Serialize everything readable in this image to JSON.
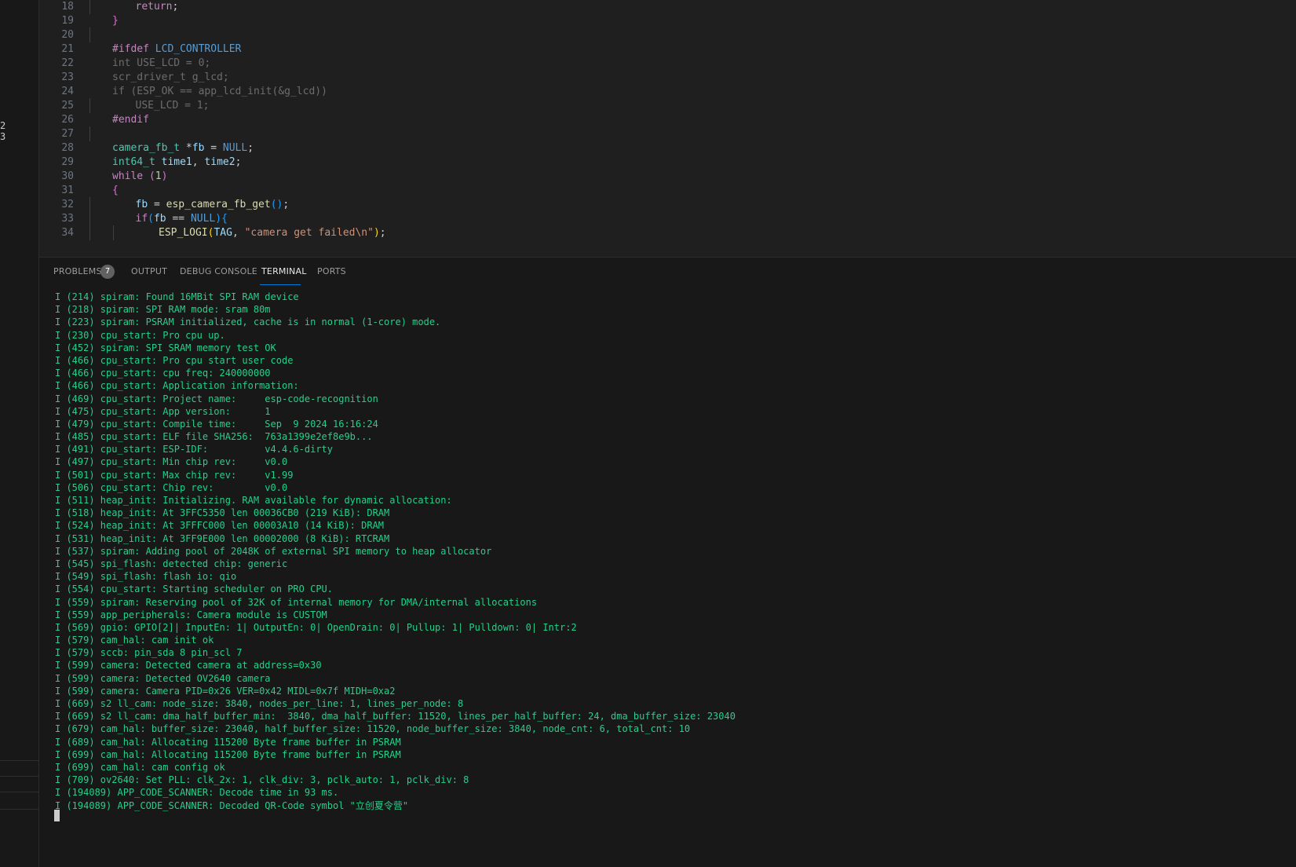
{
  "sidebar": {
    "numbers": [
      "2",
      "3"
    ]
  },
  "editor": {
    "lines": [
      {
        "n": "18",
        "indent": 2,
        "tokens": [
          [
            "kw-ctrl",
            "return"
          ],
          [
            "punc",
            ";"
          ]
        ]
      },
      {
        "n": "19",
        "indent": 1,
        "tokens": [
          [
            "brace2",
            "}"
          ]
        ]
      },
      {
        "n": "20",
        "indent": 0,
        "tokens": []
      },
      {
        "n": "21",
        "indent": 1,
        "tokens": [
          [
            "pp",
            "#ifdef"
          ],
          [
            "punc",
            " "
          ],
          [
            "macro",
            "LCD_CONTROLLER"
          ]
        ]
      },
      {
        "n": "22",
        "indent": 1,
        "tokens": [
          [
            "dim",
            "int USE_LCD = 0;"
          ]
        ]
      },
      {
        "n": "23",
        "indent": 1,
        "tokens": [
          [
            "dim",
            "scr_driver_t g_lcd;"
          ]
        ]
      },
      {
        "n": "24",
        "indent": 1,
        "tokens": [
          [
            "dim",
            "if (ESP_OK == app_lcd_init(&g_lcd))"
          ]
        ]
      },
      {
        "n": "25",
        "indent": 2,
        "tokens": [
          [
            "dim",
            "USE_LCD = 1;"
          ]
        ]
      },
      {
        "n": "26",
        "indent": 1,
        "tokens": [
          [
            "pp",
            "#endif"
          ]
        ]
      },
      {
        "n": "27",
        "indent": 0,
        "tokens": []
      },
      {
        "n": "28",
        "indent": 1,
        "tokens": [
          [
            "type",
            "camera_fb_t"
          ],
          [
            "punc",
            " *"
          ],
          [
            "var",
            "fb"
          ],
          [
            "punc",
            " = "
          ],
          [
            "macro",
            "NULL"
          ],
          [
            "punc",
            ";"
          ]
        ]
      },
      {
        "n": "29",
        "indent": 1,
        "tokens": [
          [
            "type",
            "int64_t"
          ],
          [
            "punc",
            " "
          ],
          [
            "var",
            "time1"
          ],
          [
            "punc",
            ", "
          ],
          [
            "var",
            "time2"
          ],
          [
            "punc",
            ";"
          ]
        ]
      },
      {
        "n": "30",
        "indent": 1,
        "tokens": [
          [
            "kw-ctrl",
            "while"
          ],
          [
            "punc",
            " "
          ],
          [
            "brace2",
            "("
          ],
          [
            "num",
            "1"
          ],
          [
            "brace2",
            ")"
          ]
        ]
      },
      {
        "n": "31",
        "indent": 1,
        "tokens": [
          [
            "brace2",
            "{"
          ]
        ]
      },
      {
        "n": "32",
        "indent": 2,
        "tokens": [
          [
            "var",
            "fb"
          ],
          [
            "punc",
            " = "
          ],
          [
            "fn",
            "esp_camera_fb_get"
          ],
          [
            "brace3",
            "()"
          ],
          [
            "punc",
            ";"
          ]
        ]
      },
      {
        "n": "33",
        "indent": 2,
        "tokens": [
          [
            "kw-ctrl",
            "if"
          ],
          [
            "brace3",
            "("
          ],
          [
            "var",
            "fb"
          ],
          [
            "punc",
            " == "
          ],
          [
            "macro",
            "NULL"
          ],
          [
            "brace3",
            ")"
          ],
          [
            "brace3",
            "{"
          ]
        ]
      },
      {
        "n": "34",
        "indent": 3,
        "tokens": [
          [
            "fn",
            "ESP_LOGI"
          ],
          [
            "brace1",
            "("
          ],
          [
            "var",
            "TAG"
          ],
          [
            "punc",
            ", "
          ],
          [
            "str",
            "\"camera get failed\\n\""
          ],
          [
            "brace1",
            ")"
          ],
          [
            "punc",
            ";"
          ]
        ]
      }
    ]
  },
  "panel": {
    "tabs": [
      {
        "label": "PROBLEMS",
        "active": false
      },
      {
        "label": "OUTPUT",
        "active": false
      },
      {
        "label": "DEBUG CONSOLE",
        "active": false
      },
      {
        "label": "TERMINAL",
        "active": true
      },
      {
        "label": "PORTS",
        "active": false
      }
    ],
    "problems_count": "7",
    "colors": {
      "terminal_text": "#23d18b",
      "accent": "#0078d4"
    },
    "terminal_lines": [
      "I (214) spiram: Found 16MBit SPI RAM device",
      "I (218) spiram: SPI RAM mode: sram 80m",
      "I (223) spiram: PSRAM initialized, cache is in normal (1-core) mode.",
      "I (230) cpu_start: Pro cpu up.",
      "I (452) spiram: SPI SRAM memory test OK",
      "I (466) cpu_start: Pro cpu start user code",
      "I (466) cpu_start: cpu freq: 240000000",
      "I (466) cpu_start: Application information:",
      "I (469) cpu_start: Project name:     esp-code-recognition",
      "I (475) cpu_start: App version:      1",
      "I (479) cpu_start: Compile time:     Sep  9 2024 16:16:24",
      "I (485) cpu_start: ELF file SHA256:  763a1399e2ef8e9b...",
      "I (491) cpu_start: ESP-IDF:          v4.4.6-dirty",
      "I (497) cpu_start: Min chip rev:     v0.0",
      "I (501) cpu_start: Max chip rev:     v1.99",
      "I (506) cpu_start: Chip rev:         v0.0",
      "I (511) heap_init: Initializing. RAM available for dynamic allocation:",
      "I (518) heap_init: At 3FFC5350 len 00036CB0 (219 KiB): DRAM",
      "I (524) heap_init: At 3FFFC000 len 00003A10 (14 KiB): DRAM",
      "I (531) heap_init: At 3FF9E000 len 00002000 (8 KiB): RTCRAM",
      "I (537) spiram: Adding pool of 2048K of external SPI memory to heap allocator",
      "I (545) spi_flash: detected chip: generic",
      "I (549) spi_flash: flash io: qio",
      "I (554) cpu_start: Starting scheduler on PRO CPU.",
      "I (559) spiram: Reserving pool of 32K of internal memory for DMA/internal allocations",
      "I (559) app_peripherals: Camera module is CUSTOM",
      "I (569) gpio: GPIO[2]| InputEn: 1| OutputEn: 0| OpenDrain: 0| Pullup: 1| Pulldown: 0| Intr:2",
      "I (579) cam_hal: cam init ok",
      "I (579) sccb: pin_sda 8 pin_scl 7",
      "I (599) camera: Detected camera at address=0x30",
      "I (599) camera: Detected OV2640 camera",
      "I (599) camera: Camera PID=0x26 VER=0x42 MIDL=0x7f MIDH=0xa2",
      "I (669) s2 ll_cam: node_size: 3840, nodes_per_line: 1, lines_per_node: 8",
      "I (669) s2 ll_cam: dma_half_buffer_min:  3840, dma_half_buffer: 11520, lines_per_half_buffer: 24, dma_buffer_size: 23040",
      "I (679) cam_hal: buffer_size: 23040, half_buffer_size: 11520, node_buffer_size: 3840, node_cnt: 6, total_cnt: 10",
      "I (689) cam_hal: Allocating 115200 Byte frame buffer in PSRAM",
      "I (699) cam_hal: Allocating 115200 Byte frame buffer in PSRAM",
      "I (699) cam_hal: cam config ok",
      "I (709) ov2640: Set PLL: clk_2x: 1, clk_div: 3, pclk_auto: 1, pclk_div: 8",
      "I (194089) APP_CODE_SCANNER: Decode time in 93 ms.",
      "I (194089) APP_CODE_SCANNER: Decoded QR-Code symbol \"立创夏令营\""
    ]
  }
}
